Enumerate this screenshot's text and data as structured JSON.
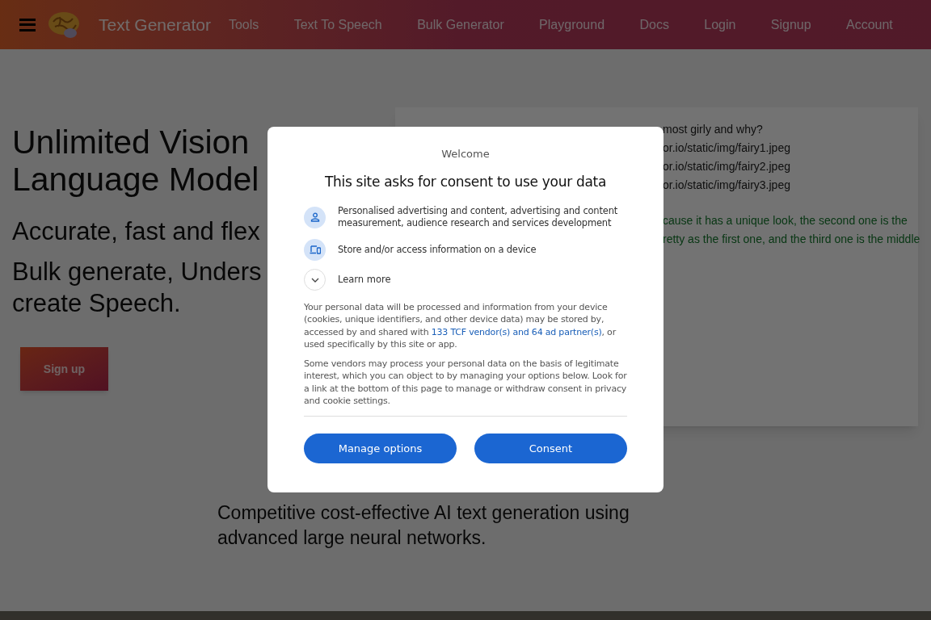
{
  "nav": {
    "brand": "Text Generator",
    "links": [
      "Tools",
      "Text To Speech",
      "Bulk Generator",
      "Playground",
      "Docs",
      "Login",
      "Signup",
      "Account"
    ]
  },
  "hero": {
    "title_lines": [
      "Unlimited Vision",
      "Language Model"
    ],
    "subtitle": "Accurate, fast and flex",
    "description_lines": [
      "Bulk generate, Unders",
      "create Speech."
    ],
    "signup_button": "Sign up"
  },
  "demo_card": {
    "prompt_lines": [
      "most girly and why?",
      "or.io/static/img/fairy1.jpeg",
      "or.io/static/img/fairy2.jpeg",
      "or.io/static/img/fairy3.jpeg"
    ],
    "response_lines": [
      "cause it has a unique look, the second one is the",
      "retty as the first one, and the third one is the middle"
    ]
  },
  "tagline": "Competitive cost-effective AI text generation using advanced large neural networks.",
  "consent_dialog": {
    "welcome": "Welcome",
    "heading": "This site asks for consent to use your data",
    "purposes": [
      {
        "kind": "person",
        "text": "Personalised advertising and content, advertising and content measurement, audience research and services development"
      },
      {
        "kind": "device",
        "text": "Store and/or access information on a device"
      }
    ],
    "learn_more": {
      "label": "Learn more",
      "expanded": false
    },
    "paragraph_1": {
      "before": "Your personal data will be processed and information from your device (cookies, unique identifiers, and other device data) may be stored by, accessed by and shared with ",
      "link": "133 TCF vendor(s) and 64 ad partner(s)",
      "after": ", or used specifically by this site or app."
    },
    "paragraph_2": "Some vendors may process your personal data on the basis of legitimate interest, which you can object to by managing your options below. Look for a link at the bottom of this page to manage or withdraw consent in privacy and cookie settings.",
    "buttons": [
      "Manage options",
      "Consent"
    ]
  }
}
